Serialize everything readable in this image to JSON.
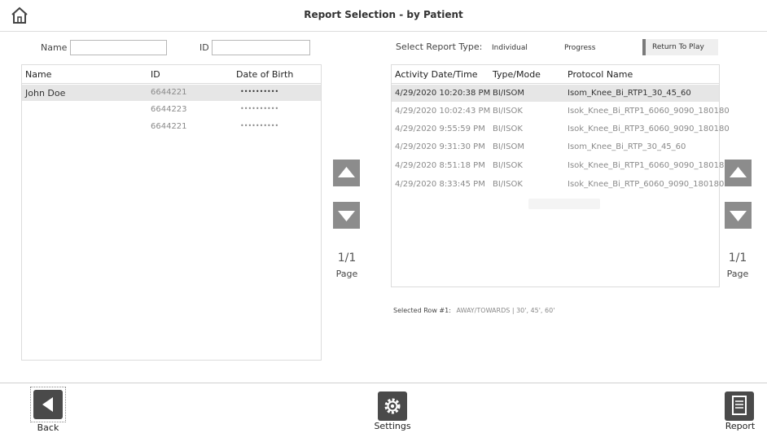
{
  "header": {
    "title": "Report Selection - by Patient",
    "home_icon": "home-icon"
  },
  "search": {
    "name_label": "Name",
    "name_value": "",
    "id_label": "ID",
    "id_value": ""
  },
  "patients": {
    "columns": [
      "Name",
      "ID",
      "Date of Birth"
    ],
    "rows": [
      {
        "name": "John Doe",
        "id": "6644221",
        "dob": "••••••••••"
      },
      {
        "name": "",
        "id": "6644223",
        "dob": "••••••••••"
      },
      {
        "name": "",
        "id": "6644221",
        "dob": "••••••••••"
      }
    ],
    "selected_index": 0
  },
  "left_pager": {
    "page": "1/1",
    "label": "Page"
  },
  "right_pager": {
    "page": "1/1",
    "label": "Page"
  },
  "report_type": {
    "label": "Select Report Type:",
    "options": [
      "Individual",
      "Progress",
      "Return To Play"
    ],
    "selected": "Return To Play"
  },
  "activities": {
    "columns": [
      "Activity Date/Time",
      "Type/Mode",
      "Protocol Name"
    ],
    "rows": [
      {
        "date": "4/29/2020 10:20:38 PM",
        "mode": "BI/ISOM",
        "protocol": "Isom_Knee_Bi_RTP1_30_45_60"
      },
      {
        "date": "4/29/2020 10:02:43 PM",
        "mode": "BI/ISOK",
        "protocol": "Isok_Knee_Bi_RTP1_6060_9090_180180"
      },
      {
        "date": "4/29/2020 9:55:59 PM",
        "mode": "BI/ISOK",
        "protocol": "Isok_Knee_Bi_RTP3_6060_9090_180180"
      },
      {
        "date": "4/29/2020 9:31:30 PM",
        "mode": "BI/ISOM",
        "protocol": "Isom_Knee_Bi_RTP_30_45_60"
      },
      {
        "date": "4/29/2020 8:51:18 PM",
        "mode": "BI/ISOK",
        "protocol": "Isok_Knee_Bi_RTP1_6060_9090_180180"
      },
      {
        "date": "4/29/2020 8:33:45 PM",
        "mode": "BI/ISOK",
        "protocol": "Isok_Knee_Bi_RTP_6060_9090_180180"
      }
    ],
    "selected_index": 0
  },
  "selected_row": {
    "label": "Selected Row #1:",
    "value": "AWAY/TOWARDS | 30', 45', 60'"
  },
  "footer": {
    "back_label": "Back",
    "settings_label": "Settings",
    "report_label": "Report"
  }
}
